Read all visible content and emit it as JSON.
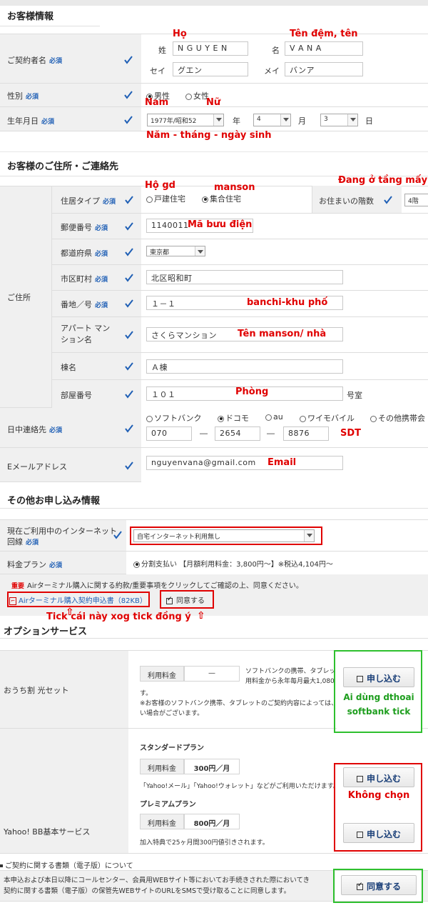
{
  "sec1": {
    "title": "お客様情報"
  },
  "contract": {
    "label": "ご契約者名",
    "req": "必須",
    "sei_label": "姓",
    "sei_val": "N G U Y E N",
    "mei_label": "名",
    "mei_val": "V A N A",
    "seikana_label": "セイ",
    "seikana_val": "グエン",
    "meikana_label": "メイ",
    "meikana_val": "バンア"
  },
  "gender": {
    "label": "性別",
    "req": "必須",
    "male": "男性",
    "female": "女性"
  },
  "dob": {
    "label": "生年月日",
    "req": "必須",
    "year": "1977年/昭和52",
    "year_unit": "年",
    "month": "4",
    "month_unit": "月",
    "day": "3",
    "day_unit": "日"
  },
  "notes": {
    "ho": "Họ",
    "ten": "Tên đệm, tên",
    "nam": "Nam",
    "nu": "Nữ",
    "dob": "Năm - tháng - ngày sinh",
    "hogd": "Hộ gd",
    "manson": "manson",
    "tang": "Đang ở tầng mấy",
    "postal": "Mã bưu điện",
    "banchi": "banchi-khu phố",
    "mansion_name": "Tên manson/ nhà",
    "room": "Phòng",
    "sdt": "SDT",
    "email": "Email",
    "tick": "Tick cái này xog tick đồng ý",
    "softbank": "Ai dùng dthoai softbank tick",
    "khong": "Không chọn"
  },
  "sec2": {
    "title": "お客様のご住所・ご連絡先"
  },
  "address": {
    "label": "ご住所",
    "type_label": "住居タイプ",
    "req": "必須",
    "detached": "戸建住宅",
    "collective": "集合住宅",
    "floor_label": "お住まいの階数",
    "floor_val": "4階",
    "postal_label": "郵便番号",
    "postal_val": "1140011",
    "pref_label": "都道府県",
    "pref_val": "東京都",
    "city_label": "市区町村",
    "city_val": "北区昭和町",
    "banchi_label": "番地／号",
    "banchi_val": "１－１",
    "apt_label": "アパート マンション名",
    "apt_val": "さくらマンション",
    "bldg_label": "棟名",
    "bldg_val": "Ａ棟",
    "room_label": "部屋番号",
    "room_val": "１０１",
    "room_unit": "号室"
  },
  "phone": {
    "label": "日中連絡先",
    "req": "必須",
    "opts": [
      "ソフトバンク",
      "ドコモ",
      "au",
      "ワイモバイル",
      "その他携帯会"
    ],
    "p1": "070",
    "p2": "2654",
    "p3": "8876",
    "dash": "―"
  },
  "email": {
    "label": "Eメールアドレス",
    "val": "nguyenvana@gmail.com"
  },
  "sec3": {
    "title": "その他お申し込み情報"
  },
  "internet": {
    "label1": "現在ご利用中のインターネット",
    "label2": "回線",
    "req": "必須",
    "val": "自宅インターネット利用無し"
  },
  "plan": {
    "label": "料金プラン",
    "req": "必須",
    "val": "分割支払い 【月額利用料金：3,800円〜】※税込4,104円〜"
  },
  "important": {
    "tag": "重要",
    "text": "Airターミナル購入に関する約款/重要事項をクリックしてご確認の上、同意ください。",
    "pdf": "Airターミナル購入契約申込書（82KB）",
    "agree": "同意する"
  },
  "sec4": {
    "title": "オプションサービス"
  },
  "ouchi": {
    "label": "おうち割 光セット",
    "fee_label": "利用料金",
    "fee_val": "—",
    "desc1": "ソフトバンクの携帯、タブレッ",
    "desc2": "用料金から永年毎月最大1,080",
    "desc3": "す。",
    "desc4": "※お客様のソフトバンク携帯、タブレットのご契約内容によっては、",
    "desc5": "い場合がございます。",
    "btn": "申し込む"
  },
  "yahoo": {
    "label": "Yahoo! BB基本サービス",
    "std_title": "スタンダードプラン",
    "std_fee_label": "利用料金",
    "std_fee": "300円／月",
    "std_desc": "「Yahoo!メール」「Yahoo!ウォレット」などがご利用いただけます。",
    "pre_title": "プレミアムプラン",
    "pre_fee_label": "利用料金",
    "pre_fee": "800円／月",
    "pre_desc": "加入特典で25ヶ月間300円値引きされます。",
    "btn": "申し込む"
  },
  "docs": {
    "title": "ご契約に関する書類（電子版）について",
    "text1": "本申込および本日以降にコールセンター、会員用WEBサイト等においてお手続きされた際においてき",
    "text2": "契約に関する書類（電子版）の保管先WEBサイトのURLをSMSで受け取ることに同意します。",
    "btn": "同意する"
  }
}
